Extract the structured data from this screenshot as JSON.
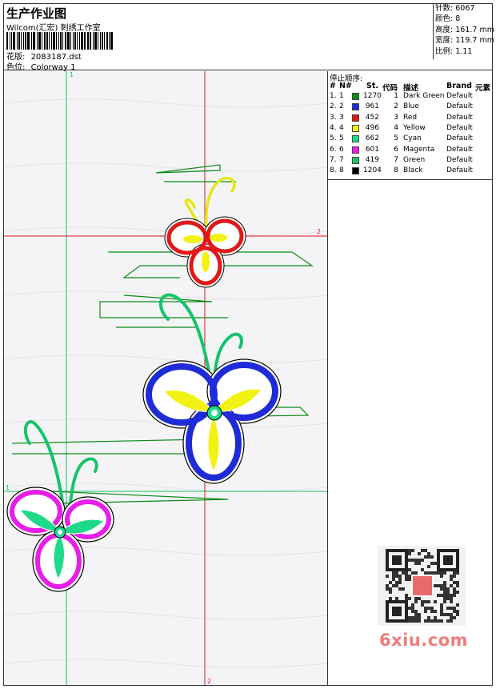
{
  "header": {
    "title": "生产作业图",
    "subtitle": "Wilcom(汇宏) 刺绣工作室",
    "design_label": "花版:",
    "design_value": "2083187.dst",
    "colorway_label": "色位:",
    "colorway_value": "Colorway 1"
  },
  "stats": [
    {
      "label": "针数:",
      "value": "6067"
    },
    {
      "label": "颜色:",
      "value": "8"
    },
    {
      "label": "高度:",
      "value": "161.7 mm"
    },
    {
      "label": "宽度:",
      "value": "119.7 mm"
    },
    {
      "label": "比例:",
      "value": "1.11"
    }
  ],
  "guides": {
    "v1": "1",
    "v2": "2",
    "h1": "1",
    "h2": "2"
  },
  "sequence": {
    "title": "停止顺序:",
    "columns": {
      "hash": "#",
      "no": "N#",
      "st": "St.",
      "code": "代码",
      "desc": "描述",
      "brand": "Brand",
      "elem": "元素"
    },
    "rows": [
      {
        "idx": "1.",
        "no": "1",
        "color": "#0a8a16",
        "st": "1270",
        "code": "1",
        "desc": "Dark Green",
        "brand": "Default"
      },
      {
        "idx": "2.",
        "no": "2",
        "color": "#1e2bd6",
        "st": "961",
        "code": "2",
        "desc": "Blue",
        "brand": "Default"
      },
      {
        "idx": "3.",
        "no": "3",
        "color": "#e01818",
        "st": "452",
        "code": "3",
        "desc": "Red",
        "brand": "Default"
      },
      {
        "idx": "4.",
        "no": "4",
        "color": "#f2f212",
        "st": "496",
        "code": "4",
        "desc": "Yellow",
        "brand": "Default"
      },
      {
        "idx": "5.",
        "no": "5",
        "color": "#1fd98a",
        "st": "662",
        "code": "5",
        "desc": "Cyan",
        "brand": "Default"
      },
      {
        "idx": "6.",
        "no": "6",
        "color": "#e61ee6",
        "st": "601",
        "code": "6",
        "desc": "Magenta",
        "brand": "Default"
      },
      {
        "idx": "7.",
        "no": "7",
        "color": "#18cc66",
        "st": "419",
        "code": "7",
        "desc": "Green",
        "brand": "Default"
      },
      {
        "idx": "8.",
        "no": "8",
        "color": "#000000",
        "st": "1204",
        "code": "8",
        "desc": "Black",
        "brand": "Default"
      }
    ]
  },
  "watermark": "6xiu.com",
  "icons": {
    "qr": "qr-code-icon"
  }
}
